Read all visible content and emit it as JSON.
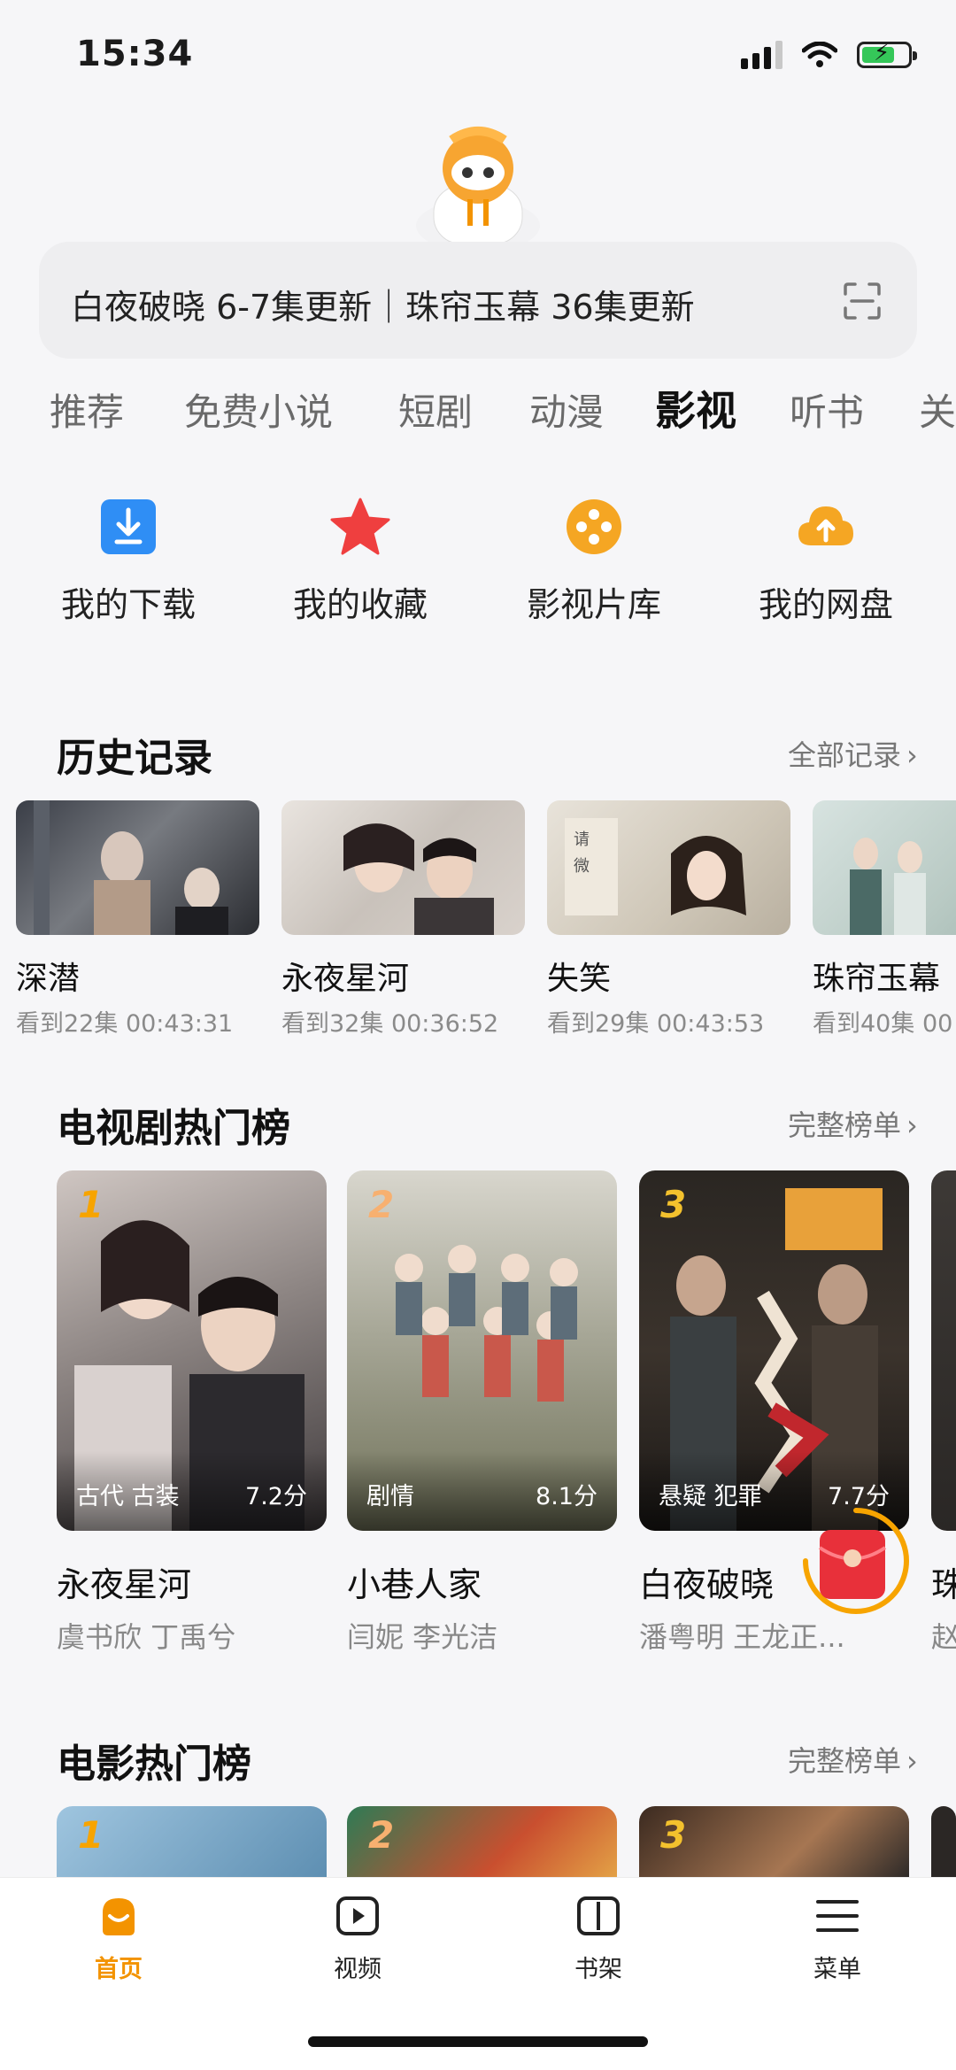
{
  "status": {
    "time": "15:34"
  },
  "search": {
    "text": "白夜破晓 6-7集更新｜珠帘玉幕 36集更新"
  },
  "tabs": [
    "推荐",
    "免费小说",
    "短剧",
    "动漫",
    "影视",
    "听书",
    "关"
  ],
  "active_tab": "影视",
  "quick_actions": [
    {
      "label": "我的下载",
      "icon": "download-icon"
    },
    {
      "label": "我的收藏",
      "icon": "star-icon"
    },
    {
      "label": "影视片库",
      "icon": "film-reel-icon"
    },
    {
      "label": "我的网盘",
      "icon": "cloud-upload-icon"
    }
  ],
  "history": {
    "title": "历史记录",
    "more": "全部记录",
    "items": [
      {
        "title": "深潜",
        "progress": "看到22集 00:43:31"
      },
      {
        "title": "永夜星河",
        "progress": "看到32集 00:36:52"
      },
      {
        "title": "失笑",
        "progress": "看到29集 00:43:53"
      },
      {
        "title": "珠帘玉幕",
        "progress": "看到40集 00"
      }
    ]
  },
  "tv_rank": {
    "title": "电视剧热门榜",
    "more": "完整榜单",
    "items": [
      {
        "rank": "1",
        "tags": "古代 古装",
        "score": "7.2分",
        "name": "永夜星河",
        "cast": "虞书欣 丁禹兮"
      },
      {
        "rank": "2",
        "tags": "剧情",
        "score": "8.1分",
        "name": "小巷人家",
        "cast": "闫妮 李光洁"
      },
      {
        "rank": "3",
        "tags": "悬疑 犯罪",
        "score": "7.7分",
        "name": "白夜破晓",
        "cast": "潘粤明 王龙正..."
      },
      {
        "rank": "",
        "tags": "",
        "score": "",
        "name": "珠",
        "cast": "赵"
      }
    ]
  },
  "movie_rank": {
    "title": "电影热门榜",
    "more": "完整榜单",
    "items": [
      {
        "rank": "1"
      },
      {
        "rank": "2"
      },
      {
        "rank": "3"
      }
    ]
  },
  "bottom_nav": [
    {
      "label": "首页",
      "icon": "home-icon"
    },
    {
      "label": "视频",
      "icon": "video-icon"
    },
    {
      "label": "书架",
      "icon": "bookshelf-icon"
    },
    {
      "label": "菜单",
      "icon": "menu-icon"
    }
  ],
  "colors": {
    "accent": "#f39300",
    "rank1": "#f7a400",
    "red": "#e8303a"
  }
}
